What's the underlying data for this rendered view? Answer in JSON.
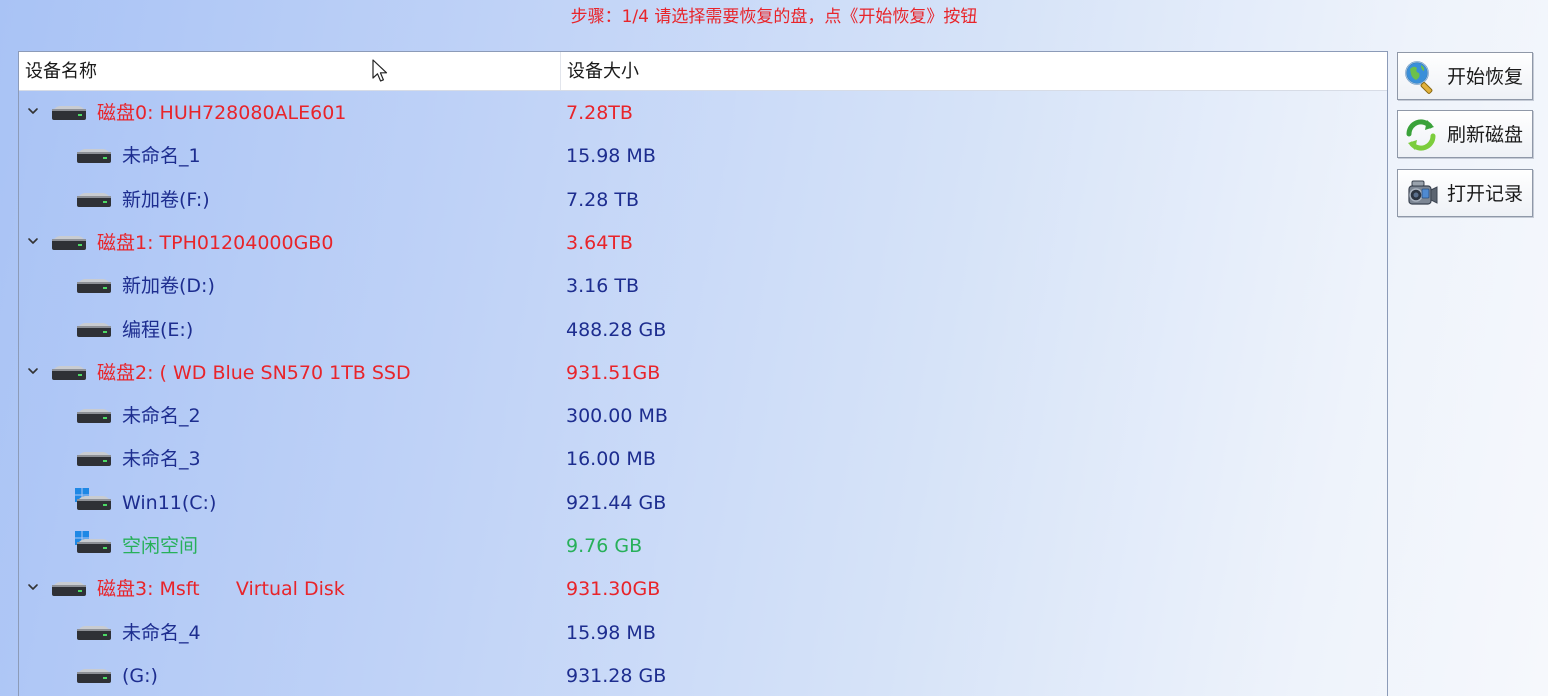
{
  "step_text": "步骤：1/4 请选择需要恢复的盘，点《开始恢复》按钮",
  "columns": {
    "name": "设备名称",
    "size": "设备大小"
  },
  "tree": [
    {
      "level": 0,
      "name": "磁盘0: HUH728080ALE601",
      "size": "7.28TB",
      "color": "#e8242a",
      "icon": "hard-disk-icon",
      "expanded": true
    },
    {
      "level": 1,
      "name": "未命名_1",
      "size": "15.98 MB",
      "color": "#1d2d8f",
      "icon": "hard-disk-icon"
    },
    {
      "level": 1,
      "name": "新加卷(F:)",
      "size": "7.28 TB",
      "color": "#1d2d8f",
      "icon": "hard-disk-icon"
    },
    {
      "level": 0,
      "name": "磁盘1: TPH01204000GB0",
      "size": "3.64TB",
      "color": "#e8242a",
      "icon": "hard-disk-icon",
      "expanded": true
    },
    {
      "level": 1,
      "name": "新加卷(D:)",
      "size": "3.16 TB",
      "color": "#1d2d8f",
      "icon": "hard-disk-icon"
    },
    {
      "level": 1,
      "name": "编程(E:)",
      "size": "488.28 GB",
      "color": "#1d2d8f",
      "icon": "hard-disk-icon"
    },
    {
      "level": 0,
      "name": "磁盘2: ( WD Blue SN570 1TB SSD",
      "size": "931.51GB",
      "color": "#e8242a",
      "icon": "hard-disk-icon",
      "expanded": true
    },
    {
      "level": 1,
      "name": "未命名_2",
      "size": "300.00 MB",
      "color": "#1d2d8f",
      "icon": "hard-disk-icon"
    },
    {
      "level": 1,
      "name": "未命名_3",
      "size": "16.00 MB",
      "color": "#1d2d8f",
      "icon": "hard-disk-icon"
    },
    {
      "level": 1,
      "name": "Win11(C:)",
      "size": "921.44 GB",
      "color": "#1d2d8f",
      "icon": "windows-disk-icon"
    },
    {
      "level": 1,
      "name": "空闲空间",
      "size": "9.76 GB",
      "color": "#27b05a",
      "icon": "windows-disk-icon"
    },
    {
      "level": 0,
      "name": "磁盘3: Msft      Virtual Disk",
      "size": "931.30GB",
      "color": "#e8242a",
      "icon": "hard-disk-icon",
      "expanded": true
    },
    {
      "level": 1,
      "name": "未命名_4",
      "size": "15.98 MB",
      "color": "#1d2d8f",
      "icon": "hard-disk-icon"
    },
    {
      "level": 1,
      "name": "(G:)",
      "size": "931.28 GB",
      "color": "#1d2d8f",
      "icon": "hard-disk-icon"
    }
  ],
  "buttons": {
    "start": {
      "label": "开始恢复",
      "icon": "magnifier-globe-icon"
    },
    "refresh": {
      "label": "刷新磁盘",
      "icon": "refresh-arrows-icon"
    },
    "open_log": {
      "label": "打开记录",
      "icon": "camcorder-icon"
    }
  },
  "colors": {
    "disk": "#e8242a",
    "partition": "#1d2d8f",
    "free_space": "#27b05a",
    "step_text": "#e8242a"
  }
}
